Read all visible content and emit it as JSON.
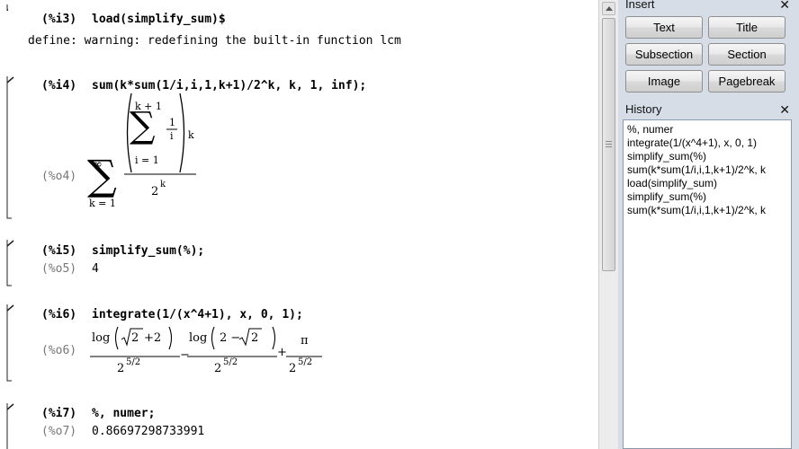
{
  "cells": [
    {
      "in_label": "(%i3)",
      "input": "load(simplify_sum)$",
      "warning": "define: warning: redefining the built-in function lcm"
    },
    {
      "in_label": "(%i4)",
      "input": "sum(k*sum(1/i,i,1,k+1)/2^k, k, 1, inf);",
      "out_label": "(%o4)",
      "math": {
        "outer_sum_upper": "∞",
        "outer_sum_lower": "k = 1",
        "inner_sum_upper": "k + 1",
        "inner_sum_lower": "i = 1",
        "frac_num": "1",
        "frac_den": "i",
        "power": "k",
        "den_base": "2",
        "den_exp": "k",
        "sigma": "∑"
      }
    },
    {
      "in_label": "(%i5)",
      "input": "simplify_sum(%);",
      "out_label": "(%o5)",
      "output": "4"
    },
    {
      "in_label": "(%i6)",
      "input": "integrate(1/(x^4+1), x, 0, 1);",
      "out_label": "(%o6)",
      "math": {
        "t1_num_a": "log",
        "t1_num_b": "2",
        "t1_num_c": "+2",
        "t2_num_a": "log",
        "t2_num_b": "2 −",
        "t2_num_c": "2",
        "t3_num": "π",
        "den_base": "2",
        "den_exp": "5/2",
        "minus": "−",
        "plus": "+",
        "sqrt": "√"
      }
    },
    {
      "in_label": "(%i7)",
      "input": "%, numer;",
      "out_label": "(%o7)",
      "output": "0.86697298733991"
    }
  ],
  "insert_panel": {
    "title": "Insert",
    "buttons": [
      "Text",
      "Title",
      "Subsection",
      "Section",
      "Image",
      "Pagebreak"
    ]
  },
  "history_panel": {
    "title": "History",
    "items": [
      "%, numer",
      "integrate(1/(x^4+1), x, 0, 1)",
      "simplify_sum(%)",
      "sum(k*sum(1/i,i,1,k+1)/2^k, k",
      "load(simplify_sum)",
      "simplify_sum(%)",
      "sum(k*sum(1/i,i,1,k+1)/2^k, k"
    ]
  },
  "icons": {
    "close": "close-icon"
  },
  "colors": {
    "sidebar_bg": "#d6dde6",
    "output_label": "#777777"
  }
}
